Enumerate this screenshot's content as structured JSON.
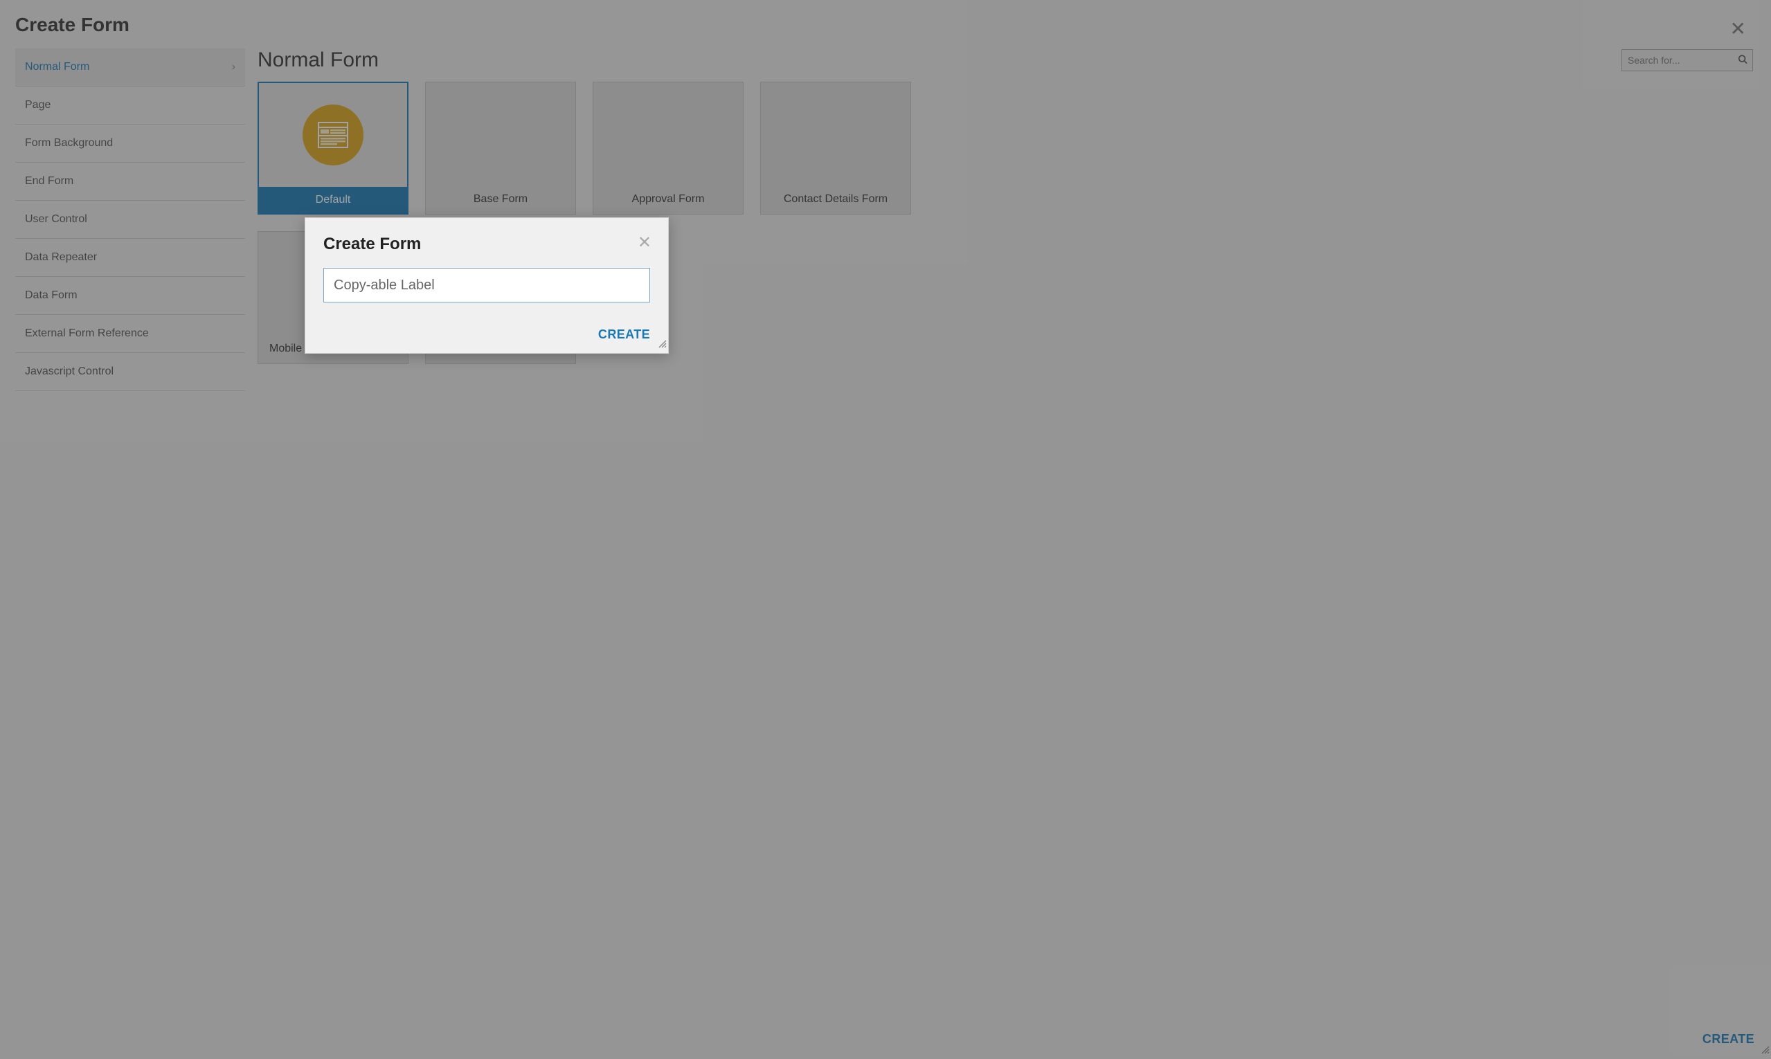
{
  "page": {
    "title": "Create Form",
    "create_label": "CREATE"
  },
  "sidebar": {
    "items": [
      {
        "label": "Normal Form",
        "active": true
      },
      {
        "label": "Page"
      },
      {
        "label": "Form Background"
      },
      {
        "label": "End Form"
      },
      {
        "label": "User Control"
      },
      {
        "label": "Data Repeater"
      },
      {
        "label": "Data Form"
      },
      {
        "label": "External Form Reference"
      },
      {
        "label": "Javascript Control"
      }
    ]
  },
  "main": {
    "title": "Normal Form",
    "search_placeholder": "Search for...",
    "cards": [
      {
        "label": "Default",
        "active": true
      },
      {
        "label": "Base Form"
      },
      {
        "label": "Approval Form"
      },
      {
        "label": "Contact Details Form"
      },
      {
        "label": "Mobile F"
      },
      {
        "label": ""
      }
    ]
  },
  "dialog": {
    "title": "Create Form",
    "input_value": "Copy-able Label",
    "create_label": "CREATE"
  }
}
